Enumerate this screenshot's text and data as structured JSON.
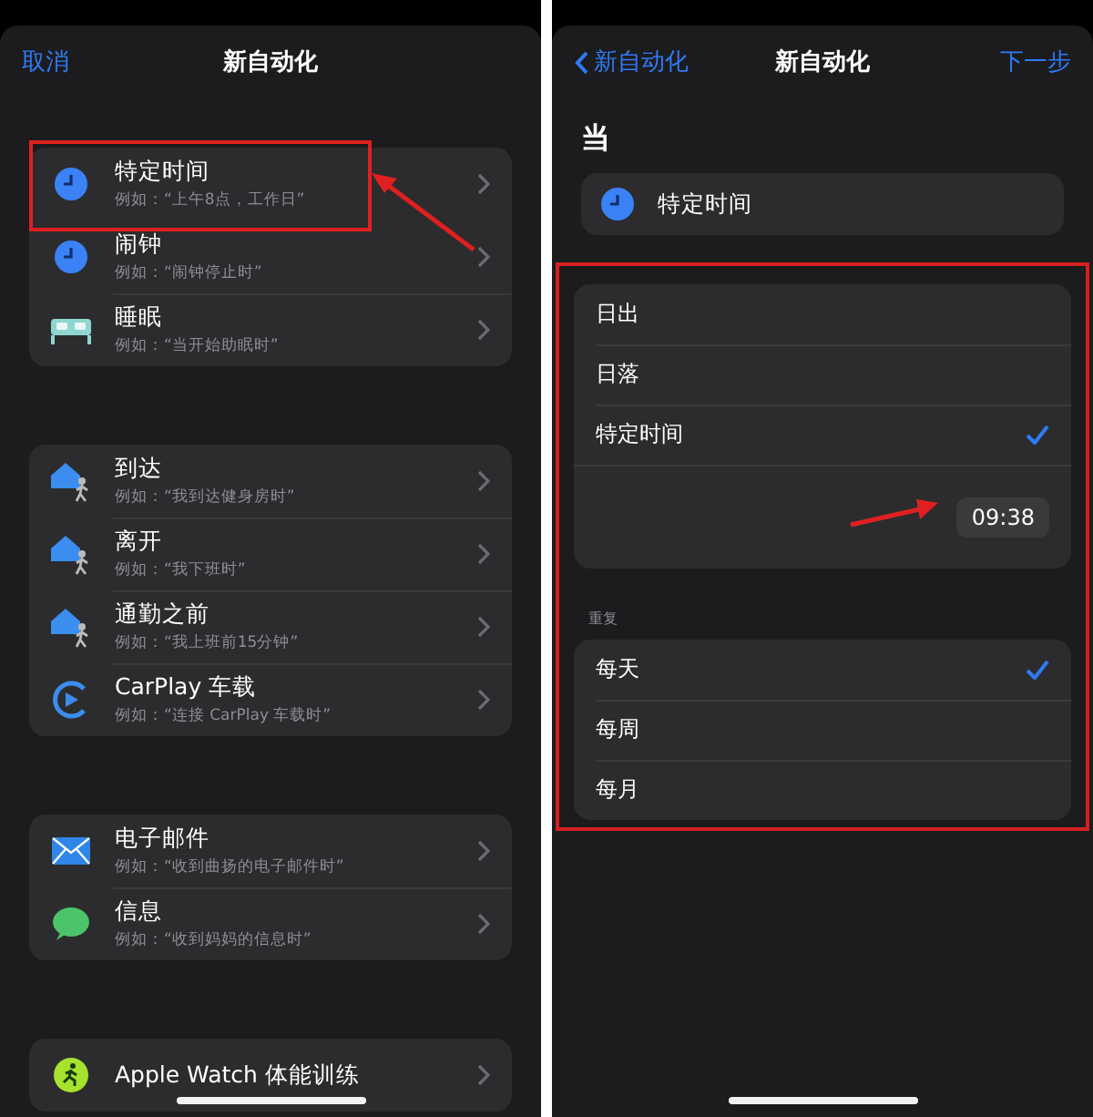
{
  "left": {
    "nav": {
      "cancel": "取消",
      "title": "新自动化"
    },
    "groups": [
      {
        "items": [
          {
            "kind": "clock",
            "title": "特定时间",
            "subtitle": "例如：“上午8点，工作日”",
            "highlighted": true
          },
          {
            "kind": "clock",
            "title": "闹钟",
            "subtitle": "例如：“闹钟停止时”",
            "highlighted": false
          },
          {
            "kind": "bed",
            "title": "睡眠",
            "subtitle": "例如：“当开始助眠时”",
            "highlighted": false
          }
        ]
      },
      {
        "items": [
          {
            "kind": "home-walk",
            "title": "到达",
            "subtitle": "例如：“我到达健身房时”",
            "highlighted": false
          },
          {
            "kind": "home-walk",
            "title": "离开",
            "subtitle": "例如：“我下班时”",
            "highlighted": false
          },
          {
            "kind": "home-walk",
            "title": "通勤之前",
            "subtitle": "例如：“我上班前15分钟”",
            "highlighted": false
          },
          {
            "kind": "carplay",
            "title": "CarPlay 车载",
            "subtitle": "例如：“连接 CarPlay 车载时”",
            "highlighted": false
          }
        ]
      },
      {
        "items": [
          {
            "kind": "mail",
            "title": "电子邮件",
            "subtitle": "例如：“收到曲扬的电子邮件时”",
            "highlighted": false
          },
          {
            "kind": "message",
            "title": "信息",
            "subtitle": "例如：“收到妈妈的信息时”",
            "highlighted": false
          }
        ]
      },
      {
        "items": [
          {
            "kind": "workout",
            "title": "Apple Watch 体能训练",
            "highlighted": false
          }
        ]
      }
    ]
  },
  "right": {
    "nav": {
      "back": "新自动化",
      "title": "新自动化",
      "next": "下一步"
    },
    "heading": "当",
    "trigger": {
      "kind": "clock",
      "label": "特定时间"
    },
    "highlighted": true,
    "options": [
      {
        "label": "日出",
        "selected": false
      },
      {
        "label": "日落",
        "selected": false
      },
      {
        "label": "特定时间",
        "selected": true
      }
    ],
    "time": "09:38",
    "repeat_label": "重复",
    "repeat": [
      {
        "label": "每天",
        "selected": true
      },
      {
        "label": "每周",
        "selected": false
      },
      {
        "label": "每月",
        "selected": false
      }
    ]
  }
}
